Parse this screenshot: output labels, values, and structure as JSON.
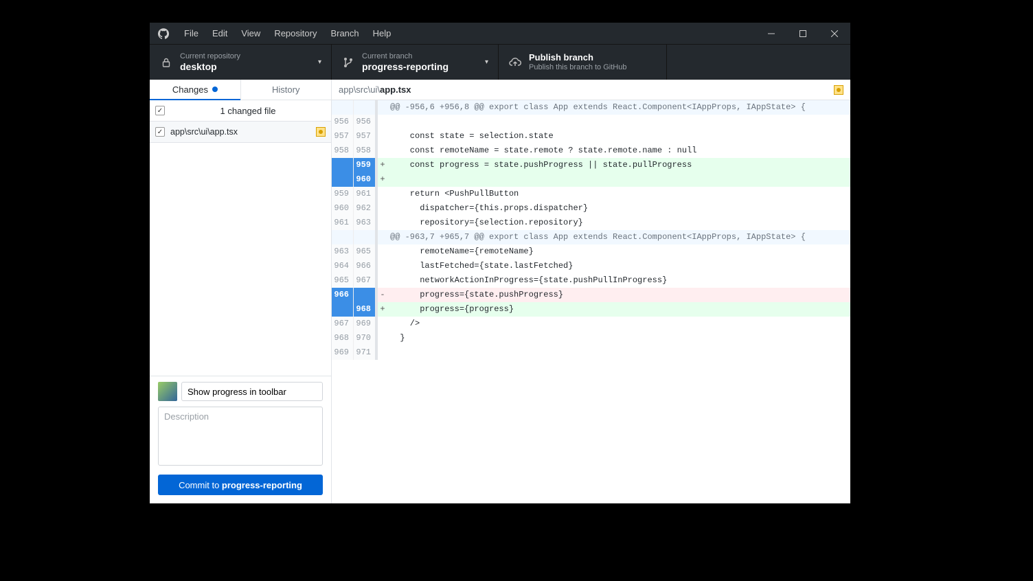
{
  "menu": {
    "items": [
      "File",
      "Edit",
      "View",
      "Repository",
      "Branch",
      "Help"
    ]
  },
  "toolbar": {
    "repo": {
      "label": "Current repository",
      "value": "desktop"
    },
    "branch": {
      "label": "Current branch",
      "value": "progress-reporting"
    },
    "publish": {
      "title": "Publish branch",
      "sub": "Publish this branch to GitHub"
    }
  },
  "sidebar": {
    "tabs": {
      "changes": "Changes",
      "history": "History"
    },
    "changed_count_text": "1 changed file",
    "files": [
      {
        "path": "app\\src\\ui\\app.tsx",
        "status": "modified"
      }
    ],
    "commit": {
      "summary_value": "Show progress in toolbar",
      "description_placeholder": "Description",
      "button_prefix": "Commit to ",
      "button_branch": "progress-reporting"
    }
  },
  "diff": {
    "path_prefix": "app\\src\\ui\\",
    "path_file": "app.tsx",
    "lines": [
      {
        "type": "hunk",
        "old": "",
        "new": "",
        "marker": "",
        "text": "@@ -956,6 +956,8 @@ export class App extends React.Component<IAppProps, IAppState> {"
      },
      {
        "type": "ctx",
        "old": "956",
        "new": "956",
        "marker": "",
        "text": ""
      },
      {
        "type": "ctx",
        "old": "957",
        "new": "957",
        "marker": "",
        "text": "    const state = selection.state"
      },
      {
        "type": "ctx",
        "old": "958",
        "new": "958",
        "marker": "",
        "text": "    const remoteName = state.remote ? state.remote.name : null"
      },
      {
        "type": "add",
        "old": "",
        "new": "959",
        "marker": "+",
        "text": "    const progress = state.pushProgress || state.pullProgress"
      },
      {
        "type": "add",
        "old": "",
        "new": "960",
        "marker": "+",
        "text": ""
      },
      {
        "type": "ctx",
        "old": "959",
        "new": "961",
        "marker": "",
        "text": "    return <PushPullButton"
      },
      {
        "type": "ctx",
        "old": "960",
        "new": "962",
        "marker": "",
        "text": "      dispatcher={this.props.dispatcher}"
      },
      {
        "type": "ctx",
        "old": "961",
        "new": "963",
        "marker": "",
        "text": "      repository={selection.repository}"
      },
      {
        "type": "hunk",
        "old": "",
        "new": "",
        "marker": "",
        "text": "@@ -963,7 +965,7 @@ export class App extends React.Component<IAppProps, IAppState> {"
      },
      {
        "type": "ctx",
        "old": "963",
        "new": "965",
        "marker": "",
        "text": "      remoteName={remoteName}"
      },
      {
        "type": "ctx",
        "old": "964",
        "new": "966",
        "marker": "",
        "text": "      lastFetched={state.lastFetched}"
      },
      {
        "type": "ctx",
        "old": "965",
        "new": "967",
        "marker": "",
        "text": "      networkActionInProgress={state.pushPullInProgress}"
      },
      {
        "type": "del",
        "old": "966",
        "new": "",
        "marker": "-",
        "text": "      progress={state.pushProgress}"
      },
      {
        "type": "add",
        "old": "",
        "new": "968",
        "marker": "+",
        "text": "      progress={progress}"
      },
      {
        "type": "ctx",
        "old": "967",
        "new": "969",
        "marker": "",
        "text": "    />"
      },
      {
        "type": "ctx",
        "old": "968",
        "new": "970",
        "marker": "",
        "text": "  }"
      },
      {
        "type": "ctx",
        "old": "969",
        "new": "971",
        "marker": "",
        "text": ""
      }
    ]
  }
}
